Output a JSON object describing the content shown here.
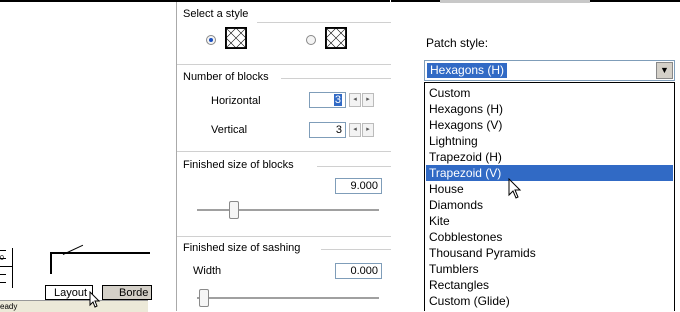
{
  "left_panel": {
    "ruler_number": "0",
    "tabs": [
      {
        "label": "Layout"
      },
      {
        "label": "Borde"
      }
    ],
    "status": "eady"
  },
  "style_panel": {
    "select_style_title": "Select a style",
    "number_of_blocks_title": "Number of blocks",
    "horizontal_label": "Horizontal",
    "horizontal_value": "3",
    "vertical_label": "Vertical",
    "vertical_value": "3",
    "finished_blocks_title": "Finished size of blocks",
    "finished_blocks_value": "9.000",
    "finished_sashing_title": "Finished size of sashing",
    "width_label": "Width",
    "width_value": "0.000"
  },
  "patch_panel": {
    "label": "Patch style:",
    "selected": "Hexagons (H)",
    "options": [
      "Custom",
      "Hexagons (H)",
      "Hexagons (V)",
      "Lightning",
      "Trapezoid (H)",
      "Trapezoid (V)",
      "House",
      "Diamonds",
      "Kite",
      "Cobblestones",
      "Thousand Pyramids",
      "Tumblers",
      "Rectangles",
      "Custom (Glide)"
    ],
    "highlighted_index": 5
  },
  "colors": {
    "selection": "#316ac5",
    "panel_bg": "#ffffff",
    "tab_inactive": "#d4d0c8"
  }
}
